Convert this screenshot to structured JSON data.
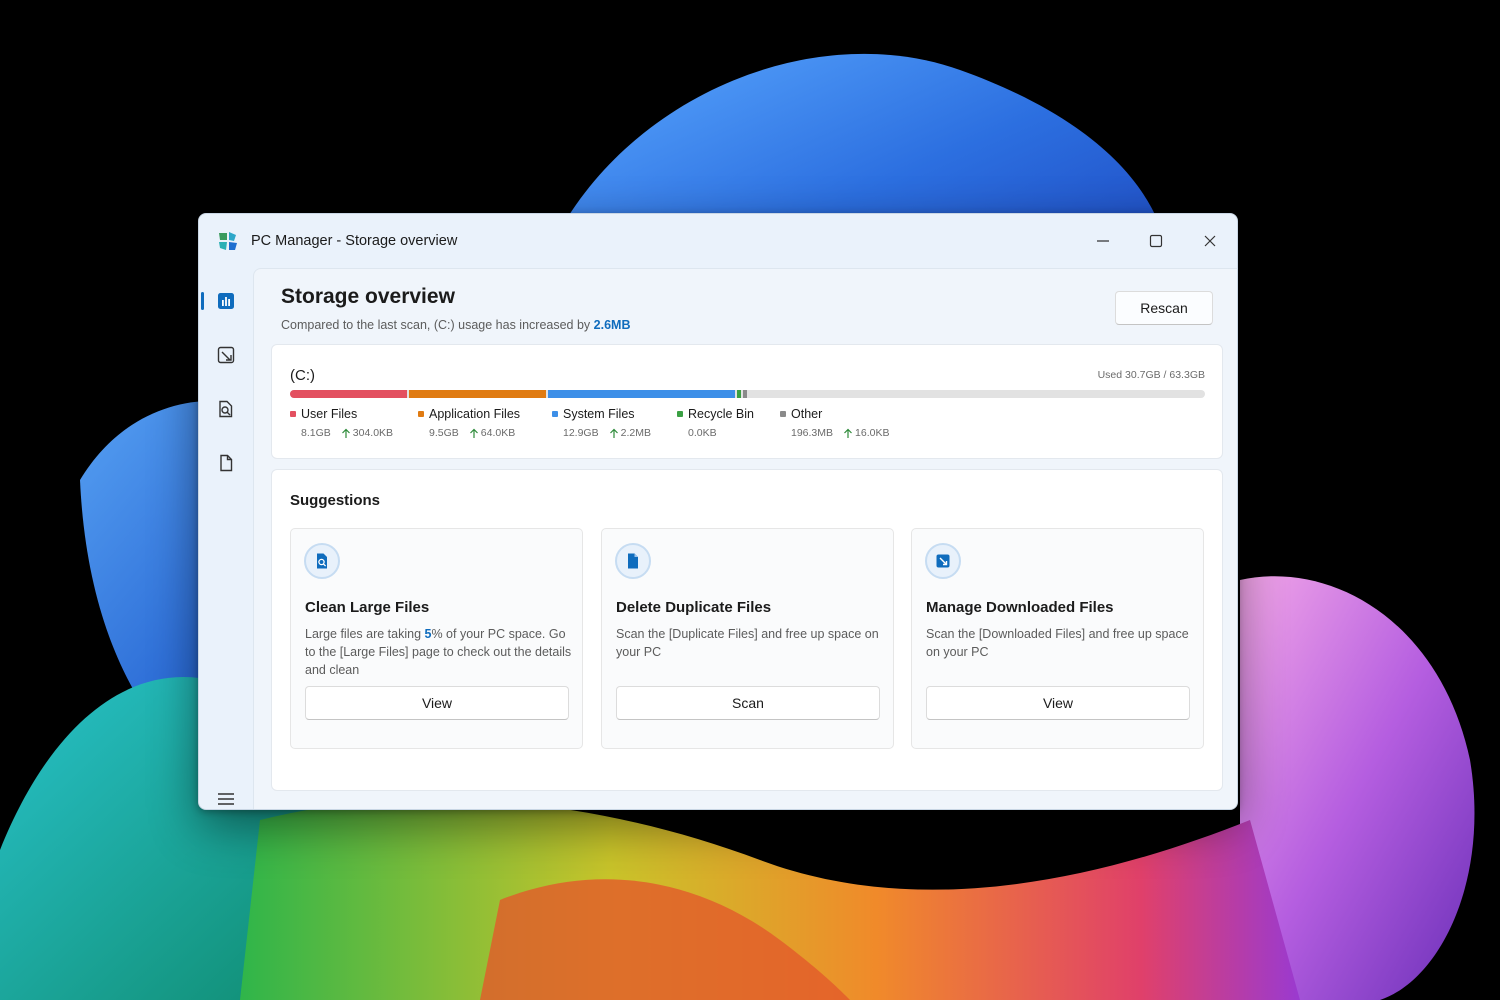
{
  "window": {
    "title": "PC Manager - Storage overview"
  },
  "nav": {
    "items": [
      {
        "icon": "chart-icon",
        "active": true
      },
      {
        "icon": "cleanup-icon",
        "active": false
      },
      {
        "icon": "file-search-icon",
        "active": false
      },
      {
        "icon": "document-icon",
        "active": false
      }
    ],
    "menu_icon": "hamburger-menu-icon"
  },
  "header": {
    "title": "Storage overview",
    "subtitle_prefix": "Compared to the last scan, (C:) usage has increased by ",
    "subtitle_value": "2.6MB",
    "rescan_label": "Rescan"
  },
  "drive": {
    "label": "(C:)",
    "used_text": "Used 30.7GB / 63.3GB",
    "used_gb": 30.7,
    "total_gb": 63.3,
    "categories": [
      {
        "name": "User Files",
        "size": "8.1GB",
        "size_gb": 8.1,
        "delta": "304.0KB",
        "color": "#e35060"
      },
      {
        "name": "Application Files",
        "size": "9.5GB",
        "size_gb": 9.5,
        "delta": "64.0KB",
        "color": "#e07b12"
      },
      {
        "name": "System Files",
        "size": "12.9GB",
        "size_gb": 12.9,
        "delta": "2.2MB",
        "color": "#3d8fe8"
      },
      {
        "name": "Recycle Bin",
        "size": "0.0KB",
        "size_gb": 0.0,
        "delta": "",
        "color": "#3aa043"
      },
      {
        "name": "Other",
        "size": "196.3MB",
        "size_gb": 0.1963,
        "delta": "16.0KB",
        "color": "#8a8a8a"
      }
    ]
  },
  "suggestions": {
    "title": "Suggestions",
    "tiles": [
      {
        "heading": "Clean Large Files",
        "desc_prefix": "Large files are taking ",
        "desc_accent": "5",
        "desc_suffix": "% of your PC space. Go to the [Large Files] page to check out the details and clean",
        "button": "View",
        "icon": "large-files-icon"
      },
      {
        "heading": "Delete Duplicate Files",
        "desc": "Scan the [Duplicate Files] and free up space on your PC",
        "button": "Scan",
        "icon": "duplicate-files-icon"
      },
      {
        "heading": "Manage Downloaded Files",
        "desc": "Scan the [Downloaded Files] and free up space on your PC",
        "button": "View",
        "icon": "downloaded-files-icon"
      }
    ]
  },
  "colors": {
    "accent": "#0f6cbd",
    "delta_up": "#2e8b3a"
  }
}
